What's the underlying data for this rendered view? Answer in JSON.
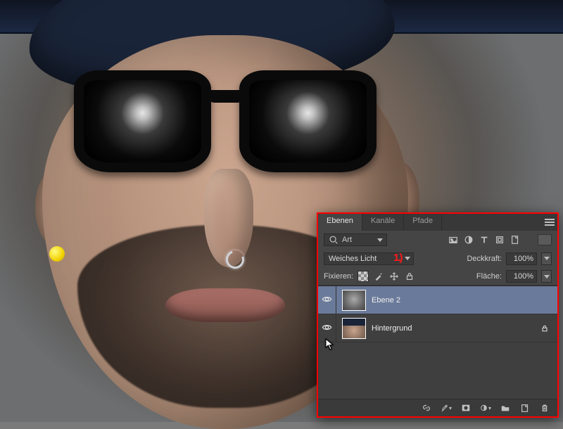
{
  "panel": {
    "tabs": {
      "layers": "Ebenen",
      "channels": "Kanäle",
      "paths": "Pfade"
    },
    "filter_label": "Art",
    "blend_mode": "Weiches Licht",
    "annotation": "1.)",
    "opacity_label": "Deckkraft:",
    "opacity_value": "100%",
    "lock_label": "Fixieren:",
    "fill_label": "Fläche:",
    "fill_value": "100%",
    "layers": [
      {
        "name": "Ebene 2",
        "visible": true,
        "selected": true,
        "locked": false
      },
      {
        "name": "Hintergrund",
        "visible": true,
        "selected": false,
        "locked": true
      }
    ]
  }
}
